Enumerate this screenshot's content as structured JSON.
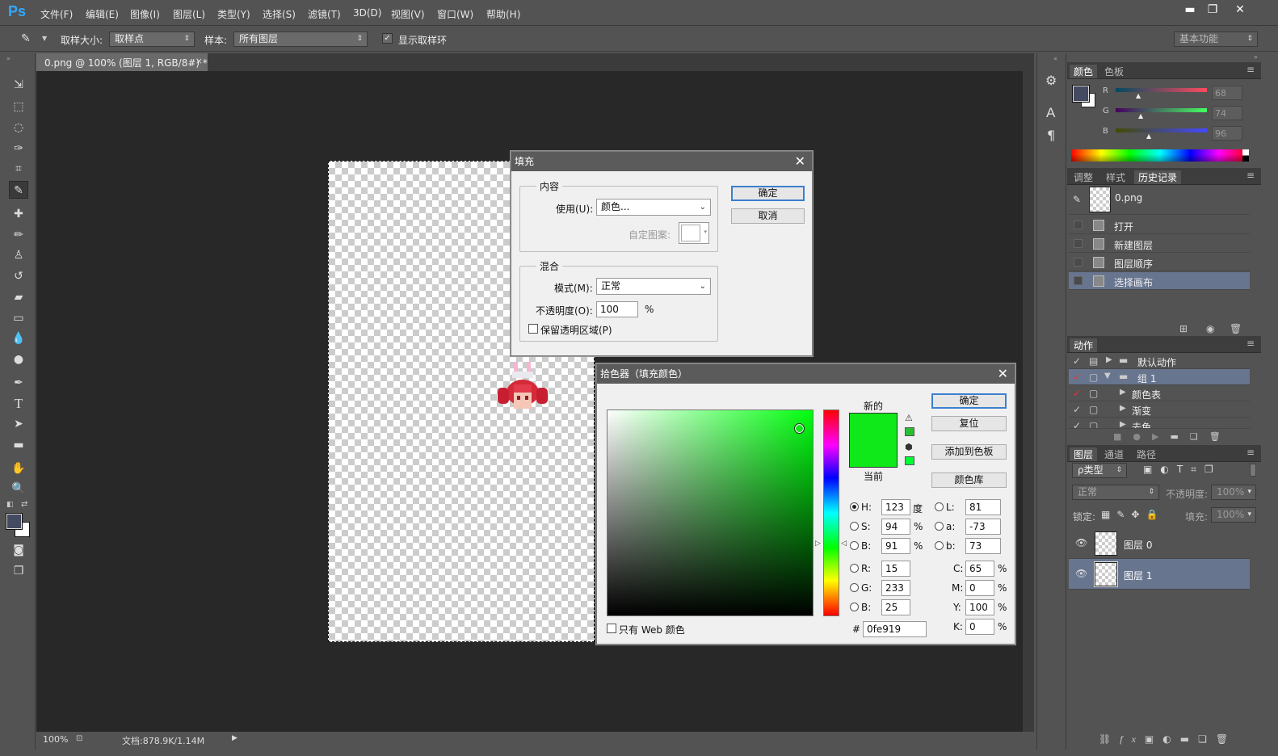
{
  "app": {
    "logo": "Ps"
  },
  "menu": [
    "文件(F)",
    "编辑(E)",
    "图像(I)",
    "图层(L)",
    "类型(Y)",
    "选择(S)",
    "滤镜(T)",
    "3D(D)",
    "视图(V)",
    "窗口(W)",
    "帮助(H)"
  ],
  "window_controls": {
    "minimize": "▬",
    "restore": "❐",
    "close": "✕"
  },
  "options": {
    "sample_size_label": "取样大小:",
    "sample_size_value": "取样点",
    "sample_label": "样本:",
    "sample_value": "所有图层",
    "show_ring_label": "显示取样环",
    "workspace": "基本功能"
  },
  "document": {
    "tab_title": "0.png @ 100% (图层 1, RGB/8#) *",
    "close": "×"
  },
  "status": {
    "zoom": "100%",
    "doc": "文档:878.9K/1.14M"
  },
  "tools": [
    "move-icon",
    "marquee-icon",
    "lasso-icon",
    "quick-select-icon",
    "crop-icon",
    "eyedropper-icon",
    "healing-icon",
    "brush-icon",
    "stamp-icon",
    "history-brush-icon",
    "eraser-icon",
    "gradient-icon",
    "blur-icon",
    "dodge-icon",
    "pen-icon",
    "type-icon",
    "path-select-icon",
    "shape-icon",
    "hand-icon",
    "zoom-icon"
  ],
  "colors": {
    "foreground": "#444a60",
    "background": "#ffffff",
    "new_color": "#0fe919",
    "accent": "#31a8ff"
  },
  "color_panel": {
    "tabs": [
      "颜色",
      "色板"
    ],
    "r_label": "R",
    "g_label": "G",
    "b_label": "B",
    "r": "68",
    "g": "74",
    "b": "96"
  },
  "history_panel": {
    "tabs": [
      "调整",
      "样式",
      "历史记录"
    ],
    "snapshot": "0.png",
    "items": [
      "打开",
      "新建图层",
      "图层顺序",
      "选择画布"
    ]
  },
  "actions_panel": {
    "tab": "动作",
    "items": [
      "默认动作",
      "组 1",
      "颜色表",
      "渐变",
      "去色"
    ]
  },
  "layers_panel": {
    "tabs": [
      "图层",
      "通道",
      "路径"
    ],
    "filter": "ρ类型",
    "blend": "正常",
    "opacity_label": "不透明度:",
    "opacity": "100%",
    "lock_label": "锁定:",
    "fill_label": "填充:",
    "fill": "100%",
    "layers": [
      "图层 0",
      "图层 1"
    ]
  },
  "fill_dialog": {
    "title": "填充",
    "content_group": "内容",
    "use_label": "使用(U):",
    "use_value": "颜色...",
    "pattern_label": "自定图案:",
    "blend_group": "混合",
    "mode_label": "模式(M):",
    "mode_value": "正常",
    "opacity_label": "不透明度(O):",
    "opacity_value": "100",
    "percent": "%",
    "preserve_label": "保留透明区域(P)",
    "ok": "确定",
    "cancel": "取消",
    "close": "✕"
  },
  "picker_dialog": {
    "title": "拾色器（填充颜色）",
    "close": "✕",
    "new_label": "新的",
    "current_label": "当前",
    "ok": "确定",
    "reset": "复位",
    "add_swatch": "添加到色板",
    "library": "颜色库",
    "h_label": "H:",
    "h": "123",
    "h_unit": "度",
    "s_label": "S:",
    "s": "94",
    "s_unit": "%",
    "b_label": "B:",
    "b": "91",
    "b_unit": "%",
    "r_label": "R:",
    "r": "15",
    "g_label": "G:",
    "g": "233",
    "bl_label": "B:",
    "bl": "25",
    "l_label": "L:",
    "l": "81",
    "a_label": "a:",
    "a": "-73",
    "lb_label": "b:",
    "lb": "73",
    "c_label": "C:",
    "c": "65",
    "m_label": "M:",
    "m": "0",
    "y_label": "Y:",
    "y": "100",
    "k_label": "K:",
    "k": "0",
    "pct": "%",
    "hash": "#",
    "hex": "0fe919",
    "web_only": "只有 Web 颜色"
  }
}
